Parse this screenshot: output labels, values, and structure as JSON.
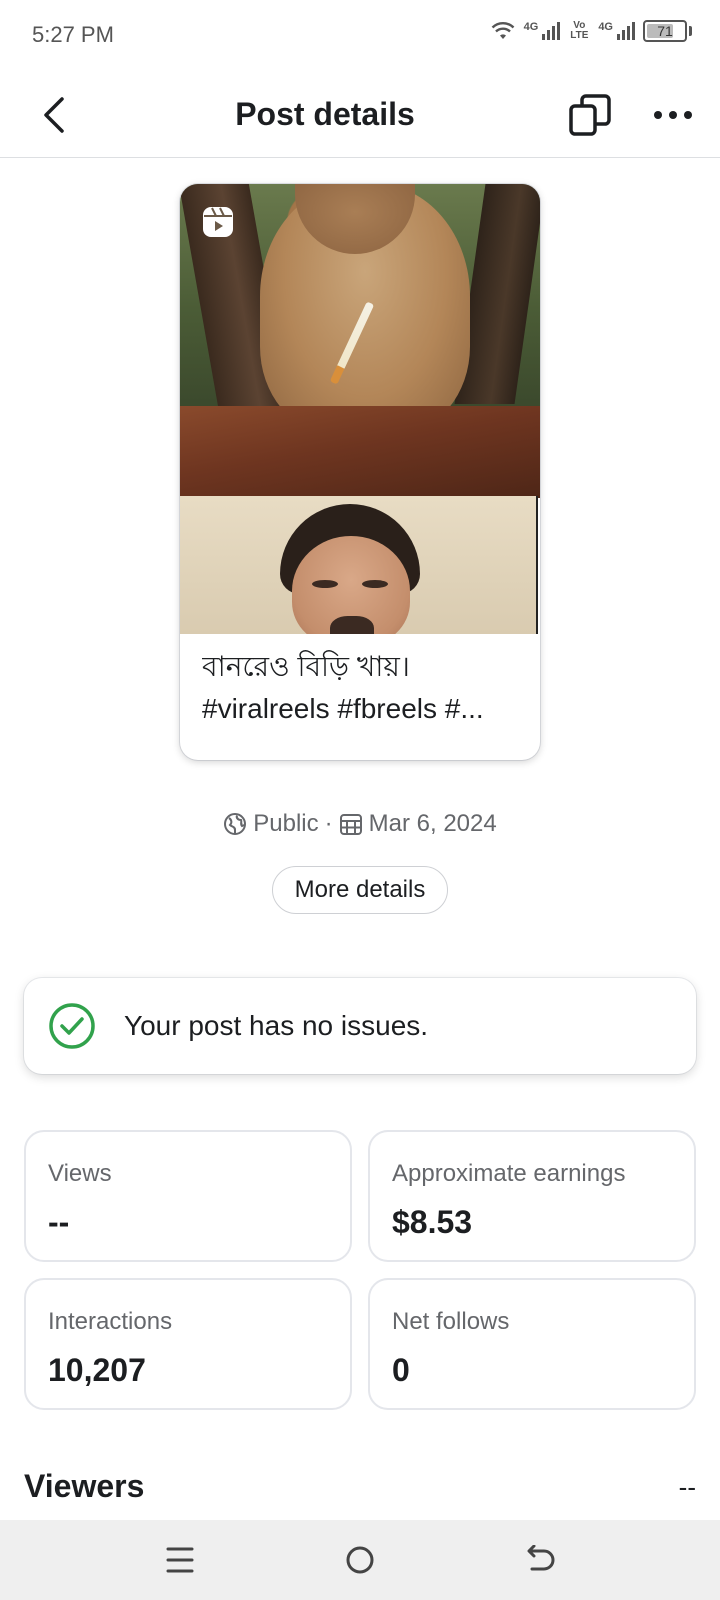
{
  "status_bar": {
    "time": "5:27 PM",
    "network_1": "4G",
    "volte": "Vo LTE",
    "network_2": "4G",
    "battery": "71",
    "battery_level": 0.71
  },
  "header": {
    "title": "Post details",
    "back_icon": "chevron-left-icon",
    "copy_icon": "copy-icon",
    "more_icon": "more-horizontal-icon"
  },
  "post": {
    "caption_line1": "বানরেও বিড়ি খায়।",
    "caption_line2": "#viralreels #fbreels #...",
    "reels_icon": "reels-icon"
  },
  "meta": {
    "privacy": "Public",
    "separator": "·",
    "date": "Mar 6, 2024"
  },
  "more_details_label": "More details",
  "issue": {
    "text": "Your post has no issues.",
    "color": "#31a24c"
  },
  "stats": [
    {
      "label": "Views",
      "value": "--"
    },
    {
      "label": "Approximate earnings",
      "value": "$8.53"
    },
    {
      "label": "Interactions",
      "value": "10,207"
    },
    {
      "label": "Net follows",
      "value": "0"
    }
  ],
  "viewers": {
    "title": "Viewers",
    "value": "--"
  },
  "nav": {
    "menu_icon": "menu-icon",
    "home_icon": "home-circle-icon",
    "back_icon": "back-arrow-icon"
  }
}
